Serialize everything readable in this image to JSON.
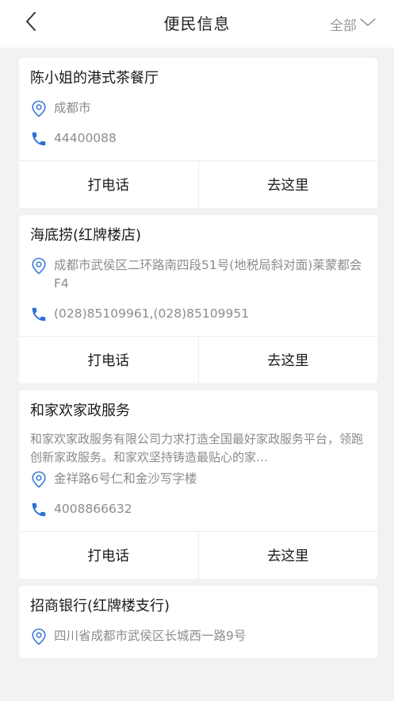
{
  "header": {
    "title": "便民信息",
    "filter_label": "全部"
  },
  "colors": {
    "accent": "#2a6fdb",
    "icon_blue": "#3b7bd6",
    "background": "#f2f2f2",
    "muted_text": "#8c8c8c"
  },
  "cards": [
    {
      "name": "陈小姐的港式茶餐厅",
      "address": "成都市",
      "phone": "44400088",
      "call_label": "打电话",
      "go_label": "去这里"
    },
    {
      "name": "海底捞(红牌楼店)",
      "address": "成都市武侯区二环路南四段51号(地税局斜对面)莱蒙都会F4",
      "phone": "(028)85109961,(028)85109951",
      "call_label": "打电话",
      "go_label": "去这里"
    },
    {
      "name": "和家欢家政服务",
      "description": "和家欢家政服务有限公司力求打造全国最好家政服务平台，领跑创新家政服务。和家欢坚持铸造最贴心的家…",
      "address": "金祥路6号仁和金沙写字楼",
      "phone": "4008866632",
      "call_label": "打电话",
      "go_label": "去这里"
    },
    {
      "name": "招商银行(红牌楼支行)",
      "address": "四川省成都市武侯区长城西一路9号"
    }
  ]
}
